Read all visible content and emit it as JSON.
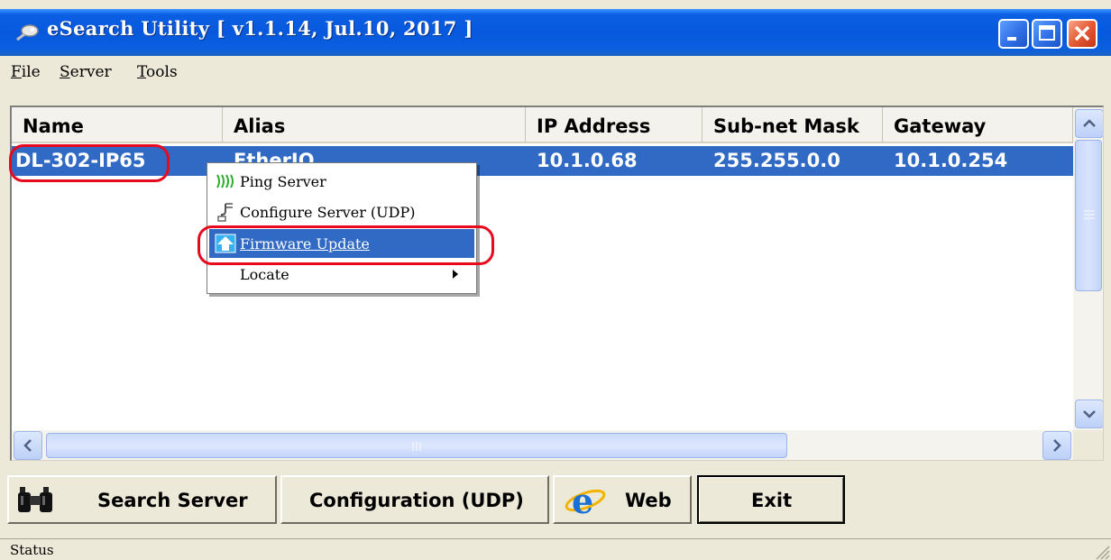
{
  "window": {
    "title": "eSearch Utility [ v1.1.14, Jul.10, 2017 ]",
    "icons": {
      "app": "magnifier-wand-icon",
      "minimize": "minimize-icon",
      "maximize": "maximize-icon",
      "close": "close-icon"
    }
  },
  "menubar": {
    "items": [
      {
        "mnemonic": "F",
        "rest": "ile"
      },
      {
        "mnemonic": "S",
        "rest": "erver"
      },
      {
        "mnemonic": "T",
        "rest": "ools"
      }
    ]
  },
  "table": {
    "columns": [
      "Name",
      "Alias",
      "IP Address",
      "Sub-net Mask",
      "Gateway"
    ],
    "rows": [
      {
        "name": "DL-302-IP65",
        "alias": "EtherIO",
        "ip": "10.1.0.68",
        "mask": "255.255.0.0",
        "gateway": "10.1.0.254",
        "selected": true
      }
    ]
  },
  "context_menu": {
    "items": [
      {
        "label": "Ping Server",
        "icon": "ping-wave-icon"
      },
      {
        "label": "Configure Server (UDP)",
        "icon": "config-plug-icon"
      },
      {
        "label": "Firmware Update",
        "icon": "upload-arrow-icon",
        "highlighted": true
      },
      {
        "label": "Locate",
        "has_submenu": true
      }
    ]
  },
  "buttons": {
    "search": "Search Server",
    "config": "Configuration (UDP)",
    "web": "Web",
    "exit": "Exit"
  },
  "status": {
    "text": "Status"
  },
  "colors": {
    "selection": "#316ac5",
    "highlight_ring": "#e8091e",
    "titlebar": "#0858dc",
    "face": "#ece9d8"
  }
}
